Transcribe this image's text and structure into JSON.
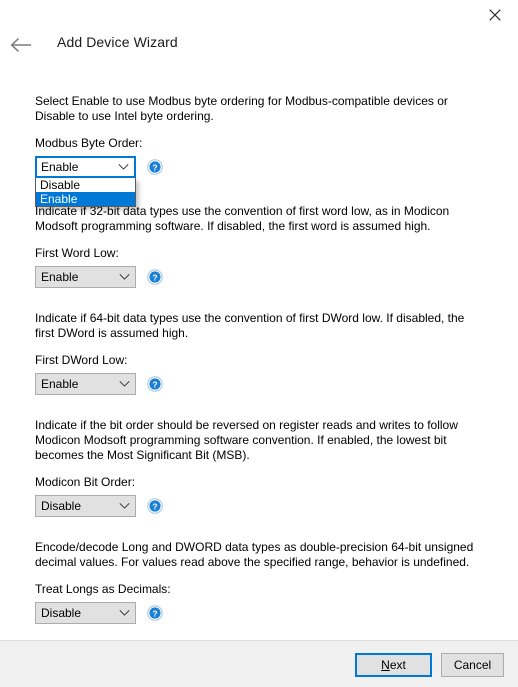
{
  "window": {
    "title": "Add Device Wizard",
    "close_icon": "close-x-icon",
    "back_icon": "arrow-left-icon",
    "help_icon": "help-question-icon",
    "chevron_icon": "chevron-down-icon",
    "accent_color": "#0078d7",
    "footer_bg": "#f0f0f0",
    "combo_bg": "#e1e1e1"
  },
  "groups": [
    {
      "description": "Select Enable to use Modbus byte ordering for Modbus-compatible devices or Disable to use Intel byte ordering.",
      "label": "Modbus Byte Order:",
      "value": "Enable",
      "open": true,
      "options": [
        "Disable",
        "Enable"
      ],
      "selected_option": "Enable"
    },
    {
      "description": "Indicate if 32-bit data types use the convention of first word low, as in Modicon Modsoft programming software. If disabled, the first word is assumed high.",
      "label": "First Word Low:",
      "value": "Enable",
      "open": false,
      "options": [
        "Disable",
        "Enable"
      ],
      "selected_option": "Enable"
    },
    {
      "description": "Indicate if 64-bit data types use the convention of first DWord low. If disabled, the first DWord is assumed high.",
      "label": "First DWord Low:",
      "value": "Enable",
      "open": false,
      "options": [
        "Disable",
        "Enable"
      ],
      "selected_option": "Enable"
    },
    {
      "description": "Indicate if the bit order should be reversed on register reads and writes to follow Modicon Modsoft programming software convention. If enabled, the lowest bit becomes the Most Significant Bit (MSB).",
      "label": "Modicon Bit Order:",
      "value": "Disable",
      "open": false,
      "options": [
        "Disable",
        "Enable"
      ],
      "selected_option": "Disable"
    },
    {
      "description": "Encode/decode Long and DWORD data types as double-precision 64-bit unsigned decimal values. For values read above the specified range, behavior is undefined.",
      "label": "Treat Longs as Decimals:",
      "value": "Disable",
      "open": false,
      "options": [
        "Disable",
        "Enable"
      ],
      "selected_option": "Disable"
    }
  ],
  "footer": {
    "next_accel": "N",
    "next_rest": "ext",
    "next_label": "Next",
    "cancel_label": "Cancel"
  }
}
